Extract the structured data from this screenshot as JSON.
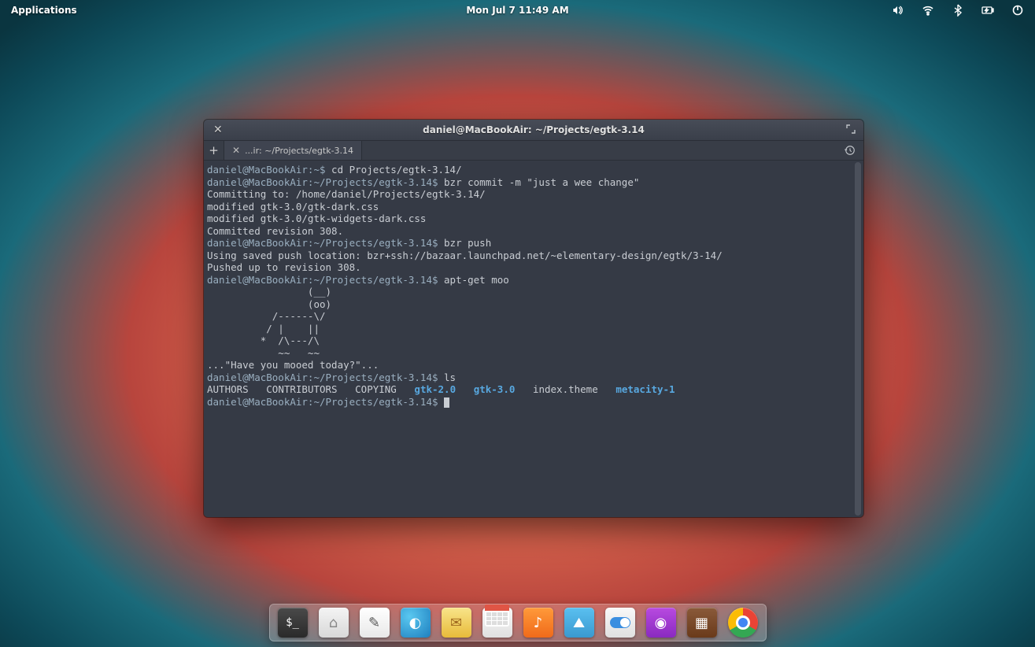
{
  "panel": {
    "applications": "Applications",
    "clock": "Mon Jul  7   11:49 AM"
  },
  "window": {
    "title": "daniel@MacBookAir: ~/Projects/egtk-3.14",
    "tab_label": "...ir: ~/Projects/egtk-3.14"
  },
  "terminal": {
    "prompt1": "daniel@MacBookAir:~$",
    "cmd1": " cd Projects/egtk-3.14/",
    "prompt2": "daniel@MacBookAir:~/Projects/egtk-3.14$",
    "cmd2": " bzr commit -m \"just a wee change\"",
    "out1": "Committing to: /home/daniel/Projects/egtk-3.14/",
    "out2": "modified gtk-3.0/gtk-dark.css",
    "out3": "modified gtk-3.0/gtk-widgets-dark.css",
    "out4": "Committed revision 308.",
    "cmd3": " bzr push",
    "out5": "Using saved push location: bzr+ssh://bazaar.launchpad.net/~elementary-design/egtk/3-14/",
    "out6": "Pushed up to revision 308.",
    "cmd4": " apt-get moo",
    "cow1": "                 (__) ",
    "cow2": "                 (oo) ",
    "cow3": "           /------\\/ ",
    "cow4": "          / |    ||   ",
    "cow5": "         *  /\\---/\\ ",
    "cow6": "            ~~   ~~   ",
    "cow7": "...\"Have you mooed today?\"...",
    "cmd5": " ls",
    "ls_authors": "AUTHORS",
    "ls_contrib": "CONTRIBUTORS",
    "ls_copying": "COPYING",
    "ls_gtk2": "gtk-2.0",
    "ls_gtk3": "gtk-3.0",
    "ls_index": "index.theme",
    "ls_metacity": "metacity-1"
  },
  "dock": {
    "terminal": "$_",
    "files": "⌂",
    "text": "✎",
    "web": "◐",
    "mail": "✉",
    "music": "♪",
    "photos": "⛰",
    "podcast": "◉",
    "mc": "▦"
  }
}
